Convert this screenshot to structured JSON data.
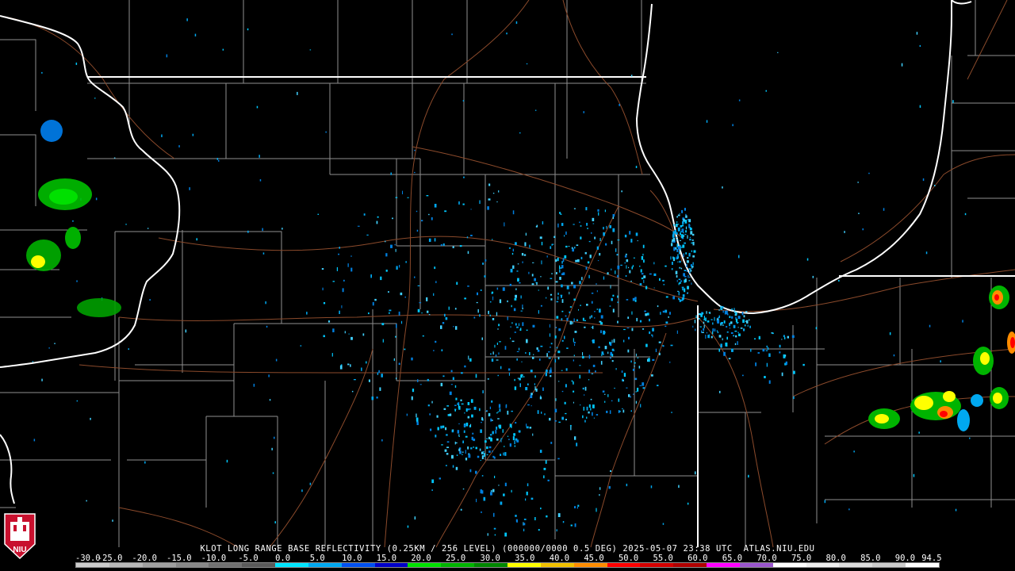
{
  "radar": {
    "site": "KLOT",
    "product_title": "KLOT LONG RANGE BASE REFLECTIVITY (0.25KM / 256 LEVEL) (000000/0000 0.5 DEG) 2025-05-07 23:38 UTC  ATLAS.NIU.EDU",
    "scale_labels": [
      "-30.0",
      "-25.0",
      "-20.0",
      "-15.0",
      "-10.0",
      "-5.0",
      "0.0",
      "5.0",
      "10.0",
      "15.0",
      "20.0",
      "25.0",
      "30.0",
      "35.0",
      "40.0",
      "45.0",
      "50.0",
      "55.0",
      "60.0",
      "65.0",
      "70.0",
      "75.0",
      "80.0",
      "85.0",
      "90.0",
      "94.5"
    ],
    "scale_colors": [
      "#cccccc",
      "#b8b8b8",
      "#a0a0a0",
      "#888888",
      "#707070",
      "#5a5a5a",
      "#00e5ff",
      "#00a8f0",
      "#0050f0",
      "#0000c8",
      "#00e000",
      "#00b400",
      "#008800",
      "#ffff00",
      "#f0c000",
      "#ff8c00",
      "#ff0000",
      "#d40000",
      "#b00000",
      "#ff00ff",
      "#9955cc",
      "#ffffff",
      "#eeeeee",
      "#dddddd",
      "#cccccc",
      "#ffffff"
    ],
    "logo_text": "NIU"
  },
  "colors": {
    "background": "#000000",
    "state_lines": "#ffffff",
    "county_lines": "#9a9a9a",
    "roads": "#8b4a2b"
  }
}
